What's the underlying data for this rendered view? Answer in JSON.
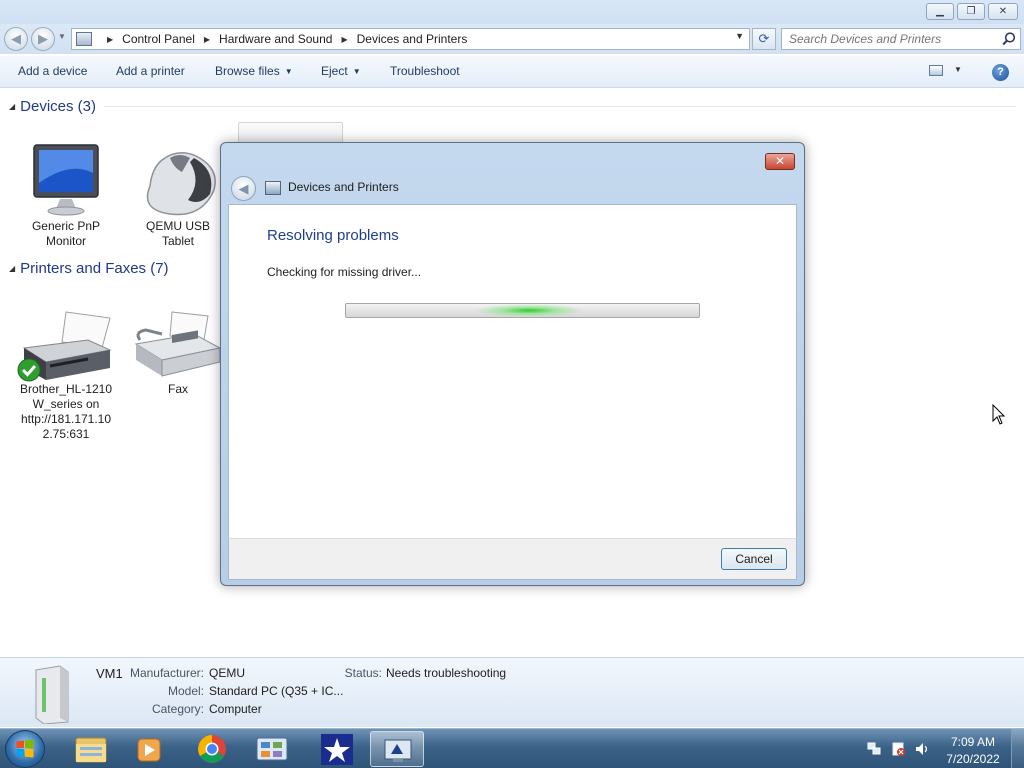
{
  "window": {
    "minimize_glyph": "▁",
    "maximize_glyph": "❐",
    "close_glyph": "✕"
  },
  "address": {
    "breadcrumbs": [
      "Control Panel",
      "Hardware and Sound",
      "Devices and Printers"
    ],
    "search_placeholder": "Search Devices and Printers"
  },
  "toolbar": {
    "add_device": "Add a device",
    "add_printer": "Add a printer",
    "browse_files": "Browse files",
    "eject": "Eject",
    "troubleshoot": "Troubleshoot",
    "help": "?"
  },
  "content": {
    "devices_header": "Devices (3)",
    "printers_header": "Printers and Faxes (7)",
    "devices": [
      {
        "label": "Generic PnP\nMonitor",
        "icon": "monitor-icon"
      },
      {
        "label": "QEMU USB\nTablet",
        "icon": "mouse-icon"
      }
    ],
    "printers": [
      {
        "label": "Brother_HL-1210\nW_series on\nhttp://181.171.10\n2.75:631",
        "icon": "printer-icon",
        "default": true
      },
      {
        "label": "Fax",
        "icon": "fax-icon"
      }
    ]
  },
  "dialog": {
    "title": "Devices and Printers",
    "close_glyph": "✕",
    "heading": "Resolving problems",
    "status": "Checking for missing driver...",
    "cancel": "Cancel",
    "progress": "indeterminate"
  },
  "details": {
    "name": "VM1",
    "manufacturer_label": "Manufacturer:",
    "manufacturer": "QEMU",
    "model_label": "Model:",
    "model": "Standard PC (Q35 + IC...",
    "category_label": "Category:",
    "category": "Computer",
    "status_label": "Status:",
    "status": "Needs troubleshooting"
  },
  "taskbar": {
    "pinned": [
      "explorer-icon",
      "media-player-icon",
      "chrome-icon",
      "control-panel-icon",
      "star-app-icon",
      "devices-printers-icon"
    ],
    "active": "devices-printers-icon"
  },
  "tray": {
    "time": "7:09 AM",
    "date": "7/20/2022",
    "icons": [
      "network-icon",
      "action-center-icon",
      "volume-icon"
    ]
  },
  "colors": {
    "accent": "#1e3a8a",
    "taskbar": "#3b6288",
    "progress_glow": "#28c828",
    "dialog_close": "#c7452f"
  }
}
